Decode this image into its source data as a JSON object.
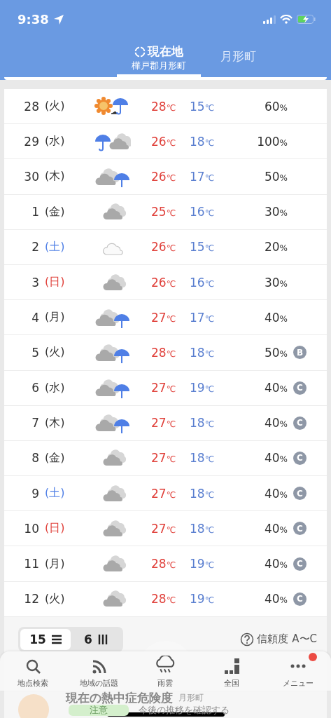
{
  "status_bar": {
    "time": "9:38"
  },
  "header_tabs": [
    {
      "label": "現在地",
      "sublabel": "樺戸郡月形町",
      "selected": true
    },
    {
      "label": "月形町",
      "selected": false
    }
  ],
  "forecast": [
    {
      "date": "28",
      "weekday": "(火)",
      "color": "#333333",
      "kind": "sun_then_rain",
      "high": "28",
      "low": "15",
      "unit": "℃",
      "precip": "60",
      "percent": "%"
    },
    {
      "date": "29",
      "weekday": "(水)",
      "color": "#333333",
      "kind": "rain_then_cloud",
      "high": "26",
      "low": "18",
      "unit": "℃",
      "precip": "100",
      "percent": "%"
    },
    {
      "date": "30",
      "weekday": "(木)",
      "color": "#333333",
      "kind": "cloud_chance_rain",
      "high": "26",
      "low": "17",
      "unit": "℃",
      "precip": "50",
      "percent": "%"
    },
    {
      "date": "1",
      "weekday": "(金)",
      "color": "#333333",
      "kind": "cloud",
      "high": "25",
      "low": "16",
      "unit": "℃",
      "precip": "30",
      "percent": "%"
    },
    {
      "date": "2",
      "weekday": "(土)",
      "color": "#4f7fe6",
      "kind": "cloud_light",
      "high": "26",
      "low": "15",
      "unit": "℃",
      "precip": "20",
      "percent": "%"
    },
    {
      "date": "3",
      "weekday": "(日)",
      "color": "#e0413b",
      "kind": "cloud",
      "high": "26",
      "low": "16",
      "unit": "℃",
      "precip": "30",
      "percent": "%"
    },
    {
      "date": "4",
      "weekday": "(月)",
      "color": "#333333",
      "kind": "cloud_chance_rain",
      "high": "27",
      "low": "17",
      "unit": "℃",
      "precip": "40",
      "percent": "%"
    },
    {
      "date": "5",
      "weekday": "(火)",
      "color": "#333333",
      "kind": "cloud_chance_rain",
      "high": "28",
      "low": "18",
      "unit": "℃",
      "precip": "50",
      "percent": "%",
      "reliability": "B"
    },
    {
      "date": "6",
      "weekday": "(水)",
      "color": "#333333",
      "kind": "cloud_chance_rain",
      "high": "27",
      "low": "19",
      "unit": "℃",
      "precip": "40",
      "percent": "%",
      "reliability": "C"
    },
    {
      "date": "7",
      "weekday": "(木)",
      "color": "#333333",
      "kind": "cloud_chance_rain",
      "high": "27",
      "low": "18",
      "unit": "℃",
      "precip": "40",
      "percent": "%",
      "reliability": "C"
    },
    {
      "date": "8",
      "weekday": "(金)",
      "color": "#333333",
      "kind": "cloud",
      "high": "27",
      "low": "18",
      "unit": "℃",
      "precip": "40",
      "percent": "%",
      "reliability": "C"
    },
    {
      "date": "9",
      "weekday": "(土)",
      "color": "#4f7fe6",
      "kind": "cloud",
      "high": "27",
      "low": "18",
      "unit": "℃",
      "precip": "40",
      "percent": "%",
      "reliability": "C"
    },
    {
      "date": "10",
      "weekday": "(日)",
      "color": "#e0413b",
      "kind": "cloud",
      "high": "27",
      "low": "18",
      "unit": "℃",
      "precip": "40",
      "percent": "%",
      "reliability": "C"
    },
    {
      "date": "11",
      "weekday": "(月)",
      "color": "#333333",
      "kind": "cloud",
      "high": "28",
      "low": "19",
      "unit": "℃",
      "precip": "40",
      "percent": "%",
      "reliability": "C"
    },
    {
      "date": "12",
      "weekday": "(火)",
      "color": "#333333",
      "kind": "cloud",
      "high": "28",
      "low": "19",
      "unit": "℃",
      "precip": "40",
      "percent": "%",
      "reliability": "C"
    }
  ],
  "range_toggle": [
    {
      "label": "15",
      "selected": true
    },
    {
      "label": "6",
      "selected": false
    }
  ],
  "reliability_help": "信頼度 A〜C",
  "heatstroke": {
    "title": "現在の熱中症危険度",
    "place": "月形町",
    "level": "注意",
    "link": "今後の推移を確認する"
  },
  "tab_bar": [
    {
      "label": "地点検索",
      "badge": false
    },
    {
      "label": "地域の話題",
      "badge": false
    },
    {
      "label": "雨雲",
      "badge": false
    },
    {
      "label": "全国",
      "badge": false
    },
    {
      "label": "メニュー",
      "badge": true
    }
  ]
}
